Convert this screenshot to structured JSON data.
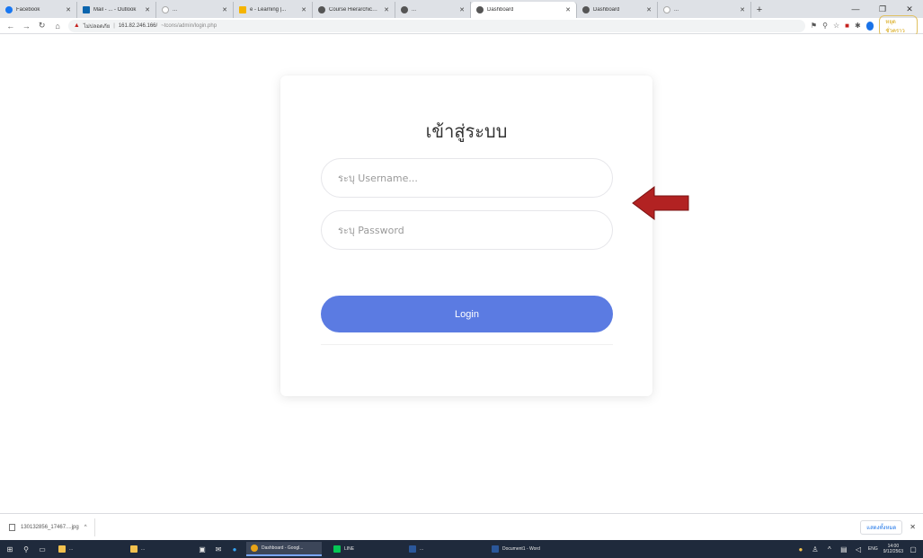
{
  "browser": {
    "tabs": [
      {
        "title": "Facebook",
        "favicon": "facebook-icon"
      },
      {
        "title": "Mail - ... - Outlook",
        "favicon": "outlook-icon"
      },
      {
        "title": "...",
        "favicon": "google-icon"
      },
      {
        "title": "e - Learning |...",
        "favicon": "elearning-icon"
      },
      {
        "title": "Course Hierarchical Vi...",
        "favicon": "course-icon"
      },
      {
        "title": "...",
        "favicon": "chrome-icon"
      },
      {
        "title": "Dashboard",
        "favicon": "dashboard-icon",
        "active": true
      },
      {
        "title": "Dashboard",
        "favicon": "dashboard-icon"
      },
      {
        "title": "...",
        "favicon": "google-icon"
      }
    ],
    "address": {
      "security_label": "ไม่ปลอดภัย",
      "url": "161.82.246.166/",
      "url_path": "~tcons/admin/login.php"
    },
    "pause_label": "หยุดชั่วคราว"
  },
  "login": {
    "title": "เข้าสู่ระบบ",
    "username_placeholder": "ระบุ Username...",
    "password_placeholder": "ระบุ Password",
    "button_label": "Login"
  },
  "annotation": {
    "arrow_color": "#b22222",
    "arrow_direction": "left"
  },
  "downloads": {
    "file_name": "130132856_17467....jpg",
    "show_all_label": "แสดงทั้งหมด"
  },
  "taskbar": {
    "apps": [
      {
        "label": "...",
        "icon": "folder-icon"
      },
      {
        "label": "...",
        "icon": "folder-icon"
      },
      {
        "label": "Dashboard - Googl...",
        "icon": "chrome-icon",
        "active": true
      },
      {
        "label": "LINE",
        "icon": "line-icon"
      },
      {
        "label": "...",
        "icon": "word-icon"
      },
      {
        "label": "Document1 - Word",
        "icon": "word-icon"
      }
    ],
    "lang": "ENG",
    "time": "14:00",
    "date": "9/12/2563"
  },
  "colors": {
    "accent": "#5b7be2",
    "arrow": "#b22222",
    "taskbar": "#1f2a3c"
  }
}
